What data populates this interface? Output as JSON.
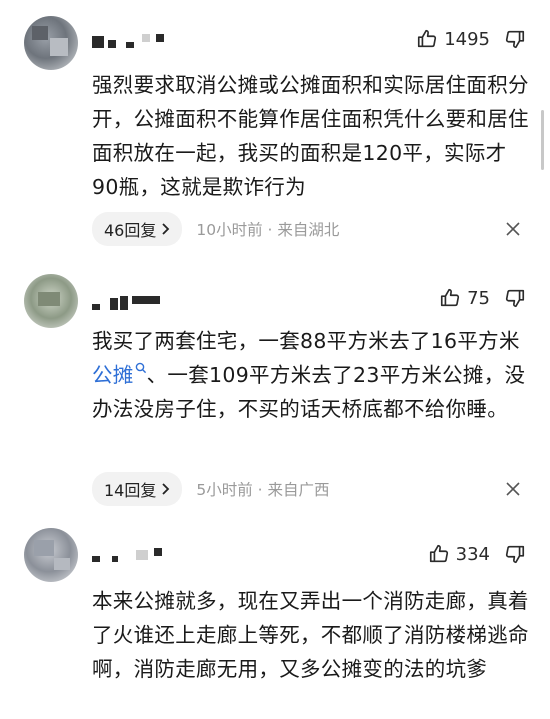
{
  "comments": [
    {
      "likes": "1495",
      "text": "强烈要求取消公摊或公摊面积和实际居住面积分开，公摊面积不能算作居住面积凭什么要和居住面积放在一起，我买的面积是120平，实际才90瓶，这就是欺诈行为",
      "replies": "46回复",
      "time": "10小时前 · 来自湖北"
    },
    {
      "likes": "75",
      "text_pre": "我买了两套住宅，一套88平方米去了16平方米",
      "text_link": "公摊",
      "text_post": "、一套109平方米去了23平方米公摊，没办法没房子住，不买的话天桥底都不给你睡。",
      "replies": "14回复",
      "time": "5小时前 · 来自广西"
    },
    {
      "likes": "334",
      "text": "本来公摊就多，现在又弄出一个消防走廊，真着了火谁还上走廊上等死，不都顺了消防楼梯逃命啊，消防走廊无用，又多公摊变的法的坑爹"
    }
  ]
}
